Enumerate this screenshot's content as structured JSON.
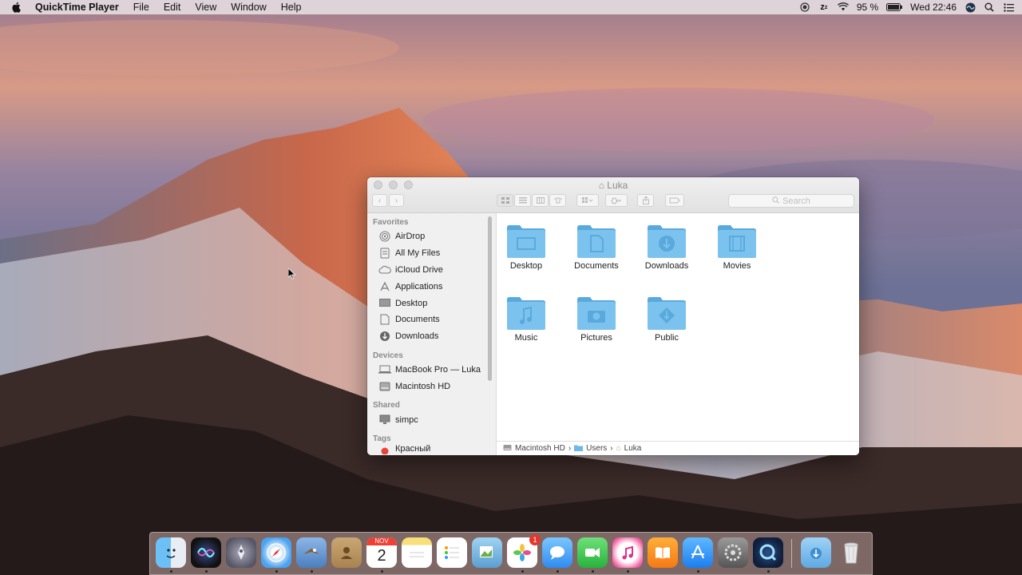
{
  "menubar": {
    "app_name": "QuickTime Player",
    "menus": [
      "File",
      "Edit",
      "View",
      "Window",
      "Help"
    ],
    "battery": "95 %",
    "clock": "Wed 22:46"
  },
  "window": {
    "title": "Luka",
    "search_placeholder": "Search",
    "sidebar": {
      "favorites_header": "Favorites",
      "favorites": [
        {
          "label": "AirDrop",
          "icon": "airdrop-icon"
        },
        {
          "label": "All My Files",
          "icon": "all-files-icon"
        },
        {
          "label": "iCloud Drive",
          "icon": "cloud-icon"
        },
        {
          "label": "Applications",
          "icon": "applications-icon"
        },
        {
          "label": "Desktop",
          "icon": "desktop-icon"
        },
        {
          "label": "Documents",
          "icon": "documents-icon"
        },
        {
          "label": "Downloads",
          "icon": "downloads-icon"
        }
      ],
      "devices_header": "Devices",
      "devices": [
        {
          "label": "MacBook Pro — Luka",
          "icon": "laptop-icon"
        },
        {
          "label": "Macintosh HD",
          "icon": "hard-drive-icon"
        }
      ],
      "shared_header": "Shared",
      "shared": [
        {
          "label": "simpc",
          "icon": "network-computer-icon"
        }
      ],
      "tags_header": "Tags",
      "tags_partial": "Красный"
    },
    "folders": [
      {
        "label": "Desktop",
        "glyph": "desktop"
      },
      {
        "label": "Documents",
        "glyph": "document"
      },
      {
        "label": "Downloads",
        "glyph": "download"
      },
      {
        "label": "Movies",
        "glyph": "film"
      },
      {
        "label": "Music",
        "glyph": "note"
      },
      {
        "label": "Pictures",
        "glyph": "camera"
      },
      {
        "label": "Public",
        "glyph": "public"
      }
    ],
    "pathbar": [
      "Macintosh HD",
      "Users",
      "Luka"
    ]
  },
  "dock": {
    "photos_badge": "1",
    "calendar_month": "NOV",
    "calendar_day": "2",
    "apps": [
      "finder",
      "siri",
      "launchpad",
      "safari",
      "mail-eagle",
      "contacts",
      "calendar",
      "notes",
      "reminders",
      "preview",
      "photos",
      "messages",
      "facetime",
      "itunes",
      "ibooks",
      "app-store",
      "system-preferences",
      "quicktime",
      "downloads-stack",
      "trash"
    ]
  },
  "colors": {
    "folder": "#7cc2ee",
    "folder_dark": "#5aa9dd",
    "accent": "#2f7de1"
  }
}
